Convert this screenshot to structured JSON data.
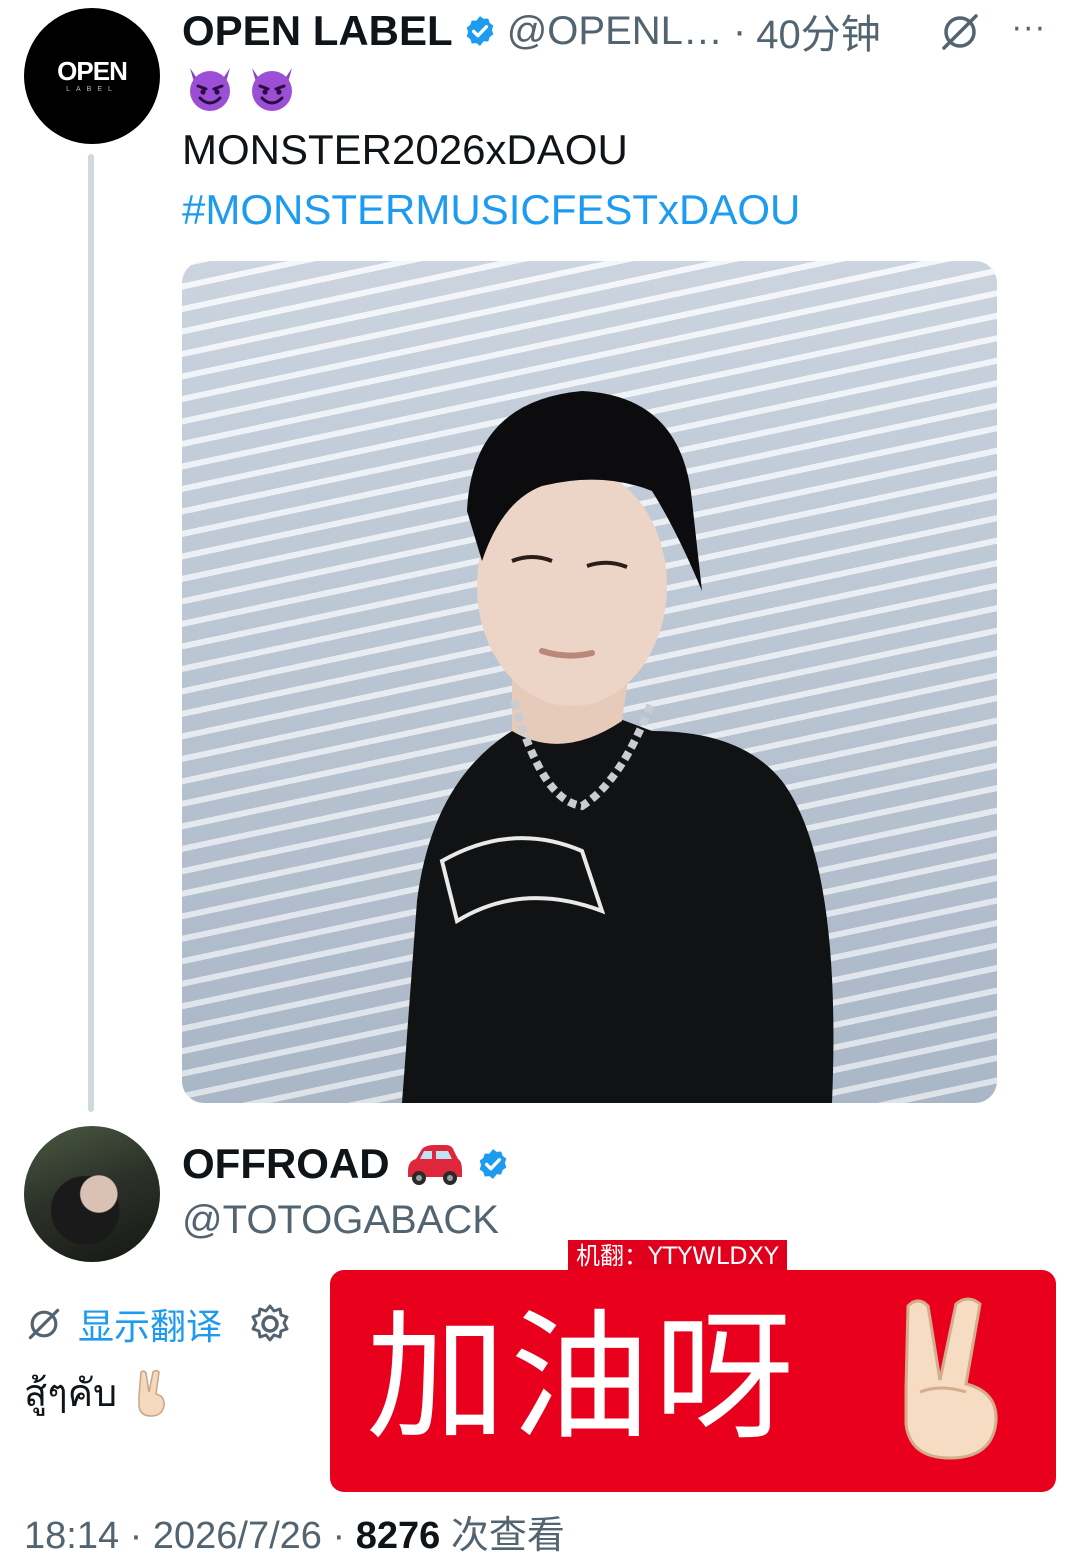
{
  "main_tweet": {
    "author_name": "OPEN LABEL",
    "handle": "@OPENL…",
    "separator": "·",
    "time": "40分钟",
    "more": "···",
    "avatar_logo": "OPEN",
    "avatar_sub": "LABEL",
    "text_line": "MONSTER2026xDAOU",
    "hashtag": "#MONSTERMUSICFESTxDAOU",
    "emoji": [
      "smiling-face-with-horns",
      "smiling-face-with-horns"
    ],
    "icons": [
      "verified-badge-icon",
      "grok-slash-icon",
      "more-icon"
    ]
  },
  "reply_tweet": {
    "author_name": "OFFROAD",
    "name_emoji": "red-car",
    "handle": "@TOTOGABACK",
    "translate_label": "显示翻译",
    "text": "สู้ๆคับ",
    "text_emoji": "victory-hand"
  },
  "overlay": {
    "tag": "机翻：YTYWLDXY",
    "caption": "加油呀",
    "caption_emoji": "victory-hand"
  },
  "footer": {
    "time": "18:14",
    "sep1": " · ",
    "date": "2026/7/26",
    "sep2": " · ",
    "views": "8276",
    "views_label": " 次查看"
  },
  "colors": {
    "link": "#1d9bf0",
    "secondary_text": "#536471",
    "overlay_red": "#e8001c",
    "thread_line": "#cfd9de"
  }
}
